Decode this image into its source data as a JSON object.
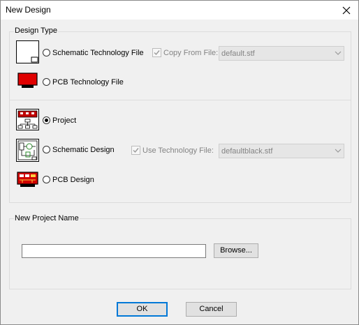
{
  "window": {
    "title": "New Design"
  },
  "design_type": {
    "label": "Design Type",
    "options": [
      {
        "label": "Schematic Technology File",
        "selected": false,
        "icon": "schematic-tech-file-icon"
      },
      {
        "label": "PCB Technology File",
        "selected": false,
        "icon": "pcb-tech-file-icon"
      },
      {
        "label": "Project",
        "selected": true,
        "icon": "project-icon"
      },
      {
        "label": "Schematic Design",
        "selected": false,
        "icon": "schematic-design-icon"
      },
      {
        "label": "PCB Design",
        "selected": false,
        "icon": "pcb-design-icon"
      }
    ],
    "copy_from_file": {
      "label": "Copy From File:",
      "checked": true,
      "disabled": true,
      "value": "default.stf"
    },
    "use_technology_file": {
      "label": "Use Technology File:",
      "checked": true,
      "disabled": true,
      "value": "defaultblack.stf"
    }
  },
  "new_project": {
    "label": "New Project Name",
    "name_value": "",
    "browse_label": "Browse..."
  },
  "buttons": {
    "ok": "OK",
    "cancel": "Cancel"
  }
}
